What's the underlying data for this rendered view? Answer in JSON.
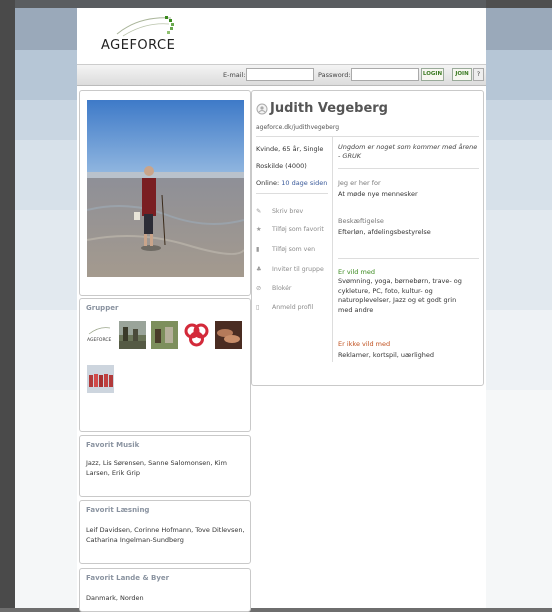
{
  "brand": {
    "logo_text": "AGEFORCE"
  },
  "login": {
    "email_label": "E-mail:",
    "password_label": "Password:",
    "login_button": "LOGIN",
    "join_button": "JOIN",
    "help": "?"
  },
  "profile": {
    "name": "Judith Vegeberg",
    "url": "ageforce.dk/judithvegeberg",
    "info": "Kvinde, 65 år, Single",
    "city": "Roskilde (4000)",
    "online_label": "Online:",
    "online_value": "10 dage siden",
    "quote": "Ungdom er noget som kommer med årene - GRUK",
    "here_for_title": "Jeg er her for",
    "here_for": "At møde nye mennesker",
    "job_title": "Beskæftigelse",
    "job": "Efterløn, afdelingsbestyrelse",
    "likes_title": "Er vild med",
    "likes": "Svømning, yoga, børnebørn, trave- og cykleture, PC, foto, kultur- og naturoplevelser, Jazz og et godt grin med andre",
    "dislikes_title": "Er ikke vild med",
    "dislikes": "Reklamer, kortspil, uærlighed"
  },
  "actions": [
    {
      "label": "Skriv brev",
      "icon": "pencil-icon",
      "glyph": "✎"
    },
    {
      "label": "Tilføj som favorit",
      "icon": "star-icon",
      "glyph": "★"
    },
    {
      "label": "Tilføj som ven",
      "icon": "friend-icon",
      "glyph": "▮"
    },
    {
      "label": "Inviter til gruppe",
      "icon": "group-icon",
      "glyph": "♣"
    },
    {
      "label": "Blokér",
      "icon": "block-icon",
      "glyph": "⊘"
    },
    {
      "label": "Anmeld profil",
      "icon": "report-icon",
      "glyph": "▯"
    }
  ],
  "groups": {
    "title": "Grupper"
  },
  "music": {
    "title": "Favorit Musik",
    "text": "Jazz, Lis Sørensen, Sanne Salomonsen, Kim Larsen, Erik Grip"
  },
  "reading": {
    "title": "Favorit Læsning",
    "text": "Leif Davidsen, Corinne Hofmann, Tove Ditlevsen, Catharina Ingelman-Sundberg"
  },
  "places": {
    "title": "Favorit Lande & Byer",
    "text": "Danmark, Norden"
  }
}
